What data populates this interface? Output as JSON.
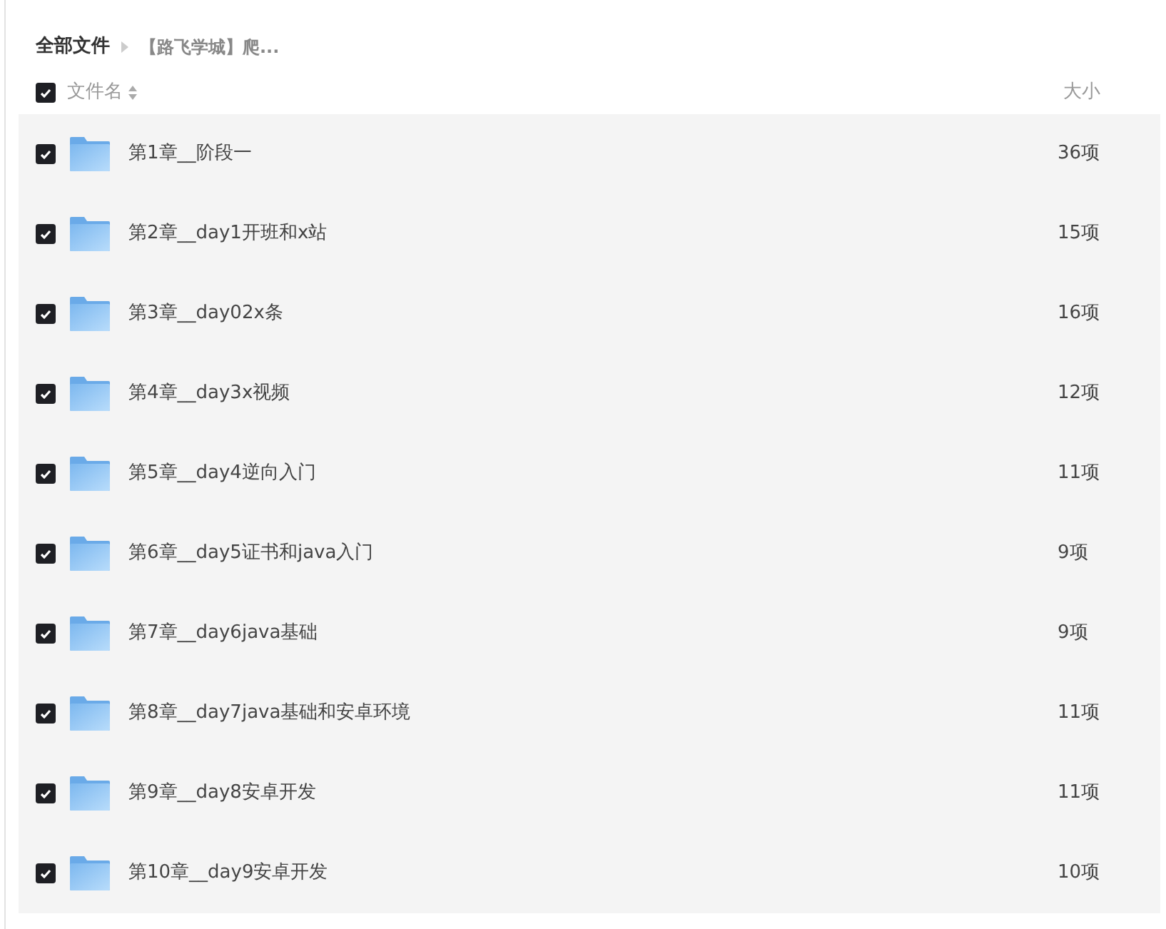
{
  "breadcrumb": [
    {
      "label": "全部文件",
      "current": false
    },
    {
      "label": "【路飞学城】爬...",
      "current": true
    }
  ],
  "header": {
    "checked": true,
    "name": "文件名",
    "size": "大小"
  },
  "files": [
    {
      "name": "第1章__阶段一",
      "size": "36项",
      "checked": true
    },
    {
      "name": "第2章__day1开班和x站",
      "size": "15项",
      "checked": true
    },
    {
      "name": "第3章__day02x条",
      "size": "16项",
      "checked": true
    },
    {
      "name": "第4章__day3x视频",
      "size": "12项",
      "checked": true
    },
    {
      "name": "第5章__day4逆向入门",
      "size": "11项",
      "checked": true
    },
    {
      "name": "第6章__day5证书和java入门",
      "size": "9项",
      "checked": true
    },
    {
      "name": "第7章__day6java基础",
      "size": "9项",
      "checked": true
    },
    {
      "name": "第8章__day7java基础和安卓环境",
      "size": "11项",
      "checked": true
    },
    {
      "name": "第9章__day8安卓开发",
      "size": "11项",
      "checked": true
    },
    {
      "name": "第10章__day9安卓开发",
      "size": "10项",
      "checked": true
    }
  ]
}
